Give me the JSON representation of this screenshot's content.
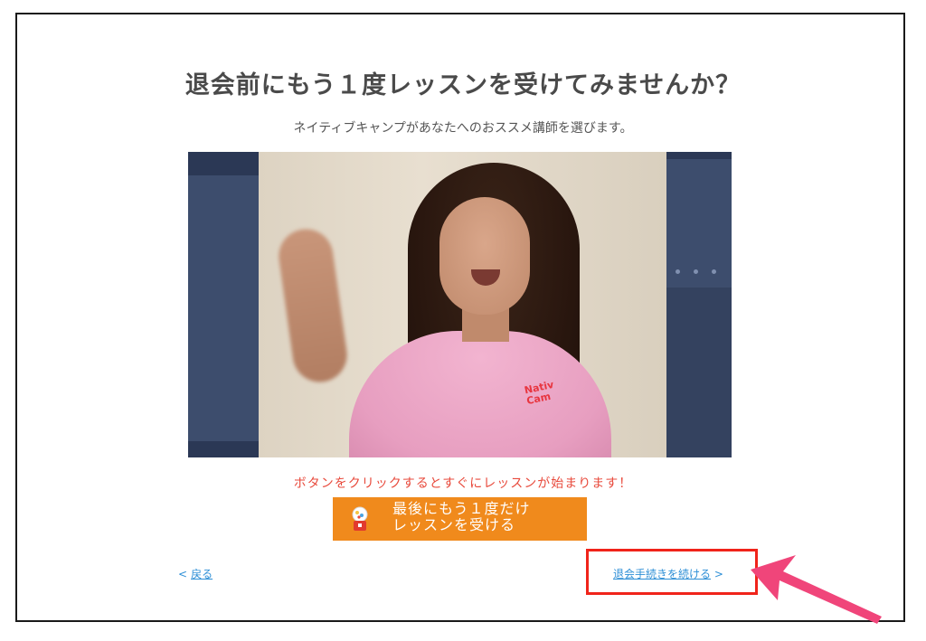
{
  "page": {
    "title": "退会前にもう１度レッスンを受けてみませんか？",
    "subtitle": "ネイティブキャンプがあなたへのおススメ講師を選びます。",
    "prompt": "ボタンをクリックするとすぐにレッスンが始まります！",
    "cta_label": "最後にもう１度だけ\nレッスンを受ける",
    "cta_icon": "gacha-capsule-icon",
    "back_label": "戻る",
    "continue_label": "退会手続きを続ける",
    "shirt_logo": "Nativ\nCam"
  },
  "colors": {
    "accent_orange": "#f08a1c",
    "prompt_red": "#e84a3c",
    "link_blue": "#2e8fd6",
    "highlight_red": "#f0241a",
    "arrow_pink": "#f0457a"
  }
}
